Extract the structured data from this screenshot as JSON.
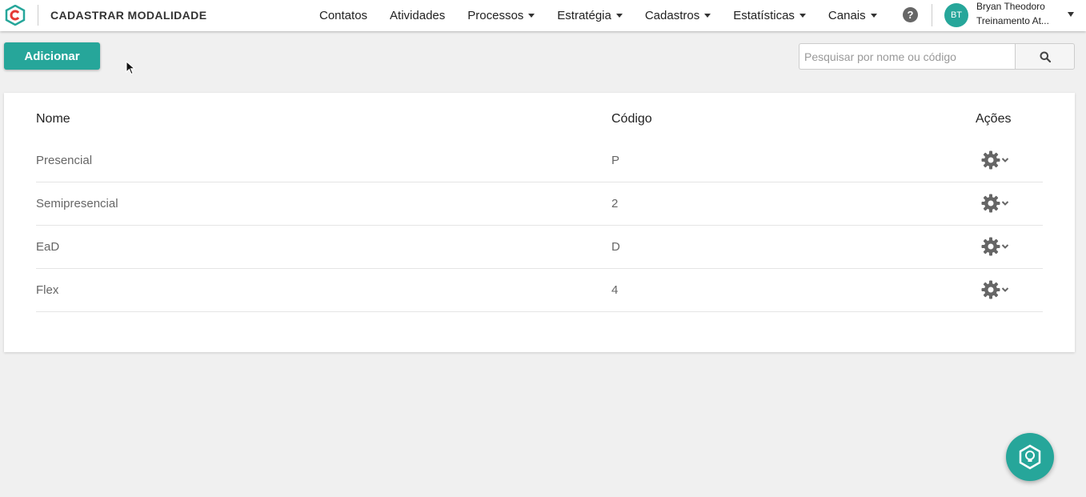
{
  "header": {
    "page_title": "CADASTRAR MODALIDADE",
    "nav": [
      {
        "label": "Contatos",
        "has_dropdown": false
      },
      {
        "label": "Atividades",
        "has_dropdown": false
      },
      {
        "label": "Processos",
        "has_dropdown": true
      },
      {
        "label": "Estratégia",
        "has_dropdown": true
      },
      {
        "label": "Cadastros",
        "has_dropdown": true
      },
      {
        "label": "Estatísticas",
        "has_dropdown": true
      },
      {
        "label": "Canais",
        "has_dropdown": true
      }
    ],
    "help_symbol": "?",
    "user": {
      "initials": "BT",
      "name": "Bryan Theodoro",
      "org": "Treinamento At..."
    }
  },
  "toolbar": {
    "add_label": "Adicionar",
    "search_placeholder": "Pesquisar por nome ou código",
    "search_value": ""
  },
  "table": {
    "headers": {
      "name": "Nome",
      "code": "Código",
      "actions": "Ações"
    },
    "rows": [
      {
        "name": "Presencial",
        "code": "P"
      },
      {
        "name": "Semipresencial",
        "code": "2"
      },
      {
        "name": "EaD",
        "code": "D"
      },
      {
        "name": "Flex",
        "code": "4"
      }
    ]
  },
  "icons": {
    "logo": "hexagon-logo-icon",
    "help": "question-circle-icon",
    "search": "search-icon",
    "row_action": "gear-icon",
    "fab": "lightbulb-hexagon-icon"
  },
  "colors": {
    "accent": "#26a69a",
    "logo_red": "#e53935",
    "background": "#f0f0f0"
  }
}
